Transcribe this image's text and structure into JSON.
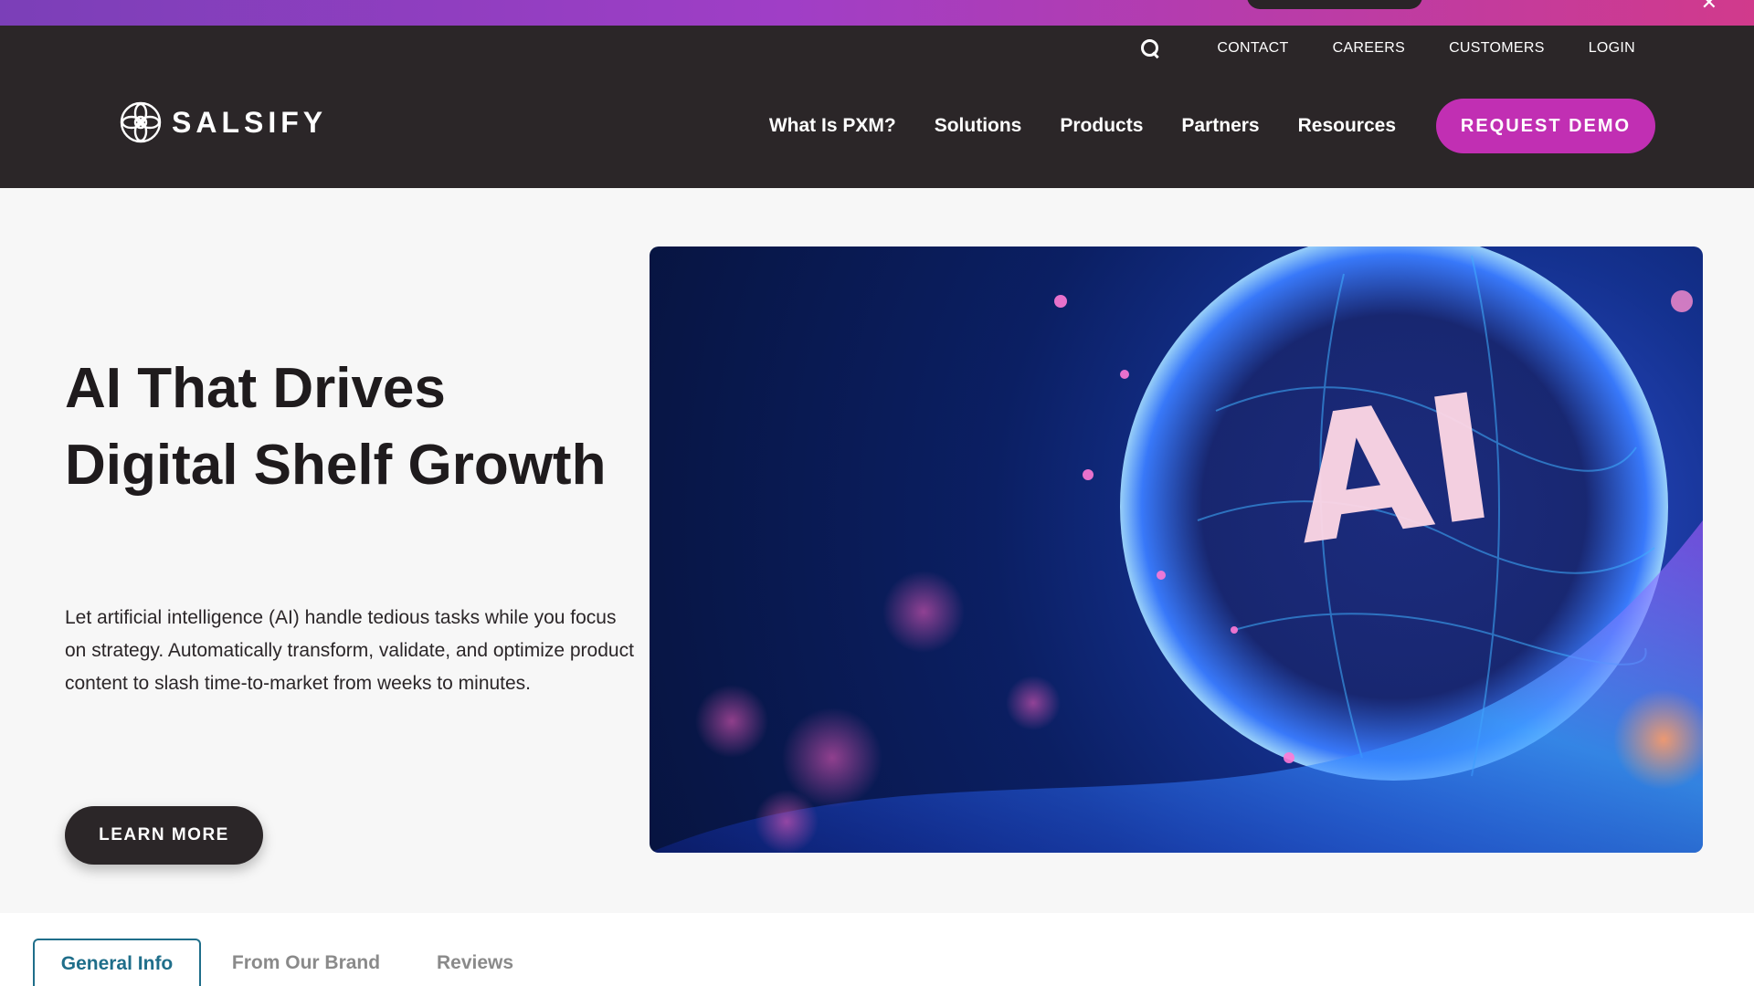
{
  "header": {
    "utility_links": [
      "CONTACT",
      "CAREERS",
      "CUSTOMERS",
      "LOGIN"
    ],
    "logo_text": "SALSIFY",
    "nav_items": [
      "What Is PXM?",
      "Solutions",
      "Products",
      "Partners",
      "Resources"
    ],
    "cta_label": "REQUEST DEMO"
  },
  "hero": {
    "title": "AI That Drives Digital Shelf Growth",
    "description": "Let artificial intelligence (AI) handle tedious tasks while you focus on strategy. Automatically transform, validate, and optimize product content to slash time-to-market from weeks to minutes.",
    "button_label": "LEARN MORE",
    "image_text": "AI"
  },
  "tabs": [
    {
      "label": "General Info",
      "active": true
    },
    {
      "label": "From Our Brand",
      "active": false
    },
    {
      "label": "Reviews",
      "active": false
    }
  ],
  "colors": {
    "header_bg": "#2b2628",
    "brand_magenta": "#c12fb3",
    "tab_active": "#1f6e8a",
    "banner_from": "#7b3fb8",
    "banner_to": "#d13a8c"
  },
  "icons": [
    "search-icon",
    "close-icon",
    "salsify-logo-icon"
  ]
}
